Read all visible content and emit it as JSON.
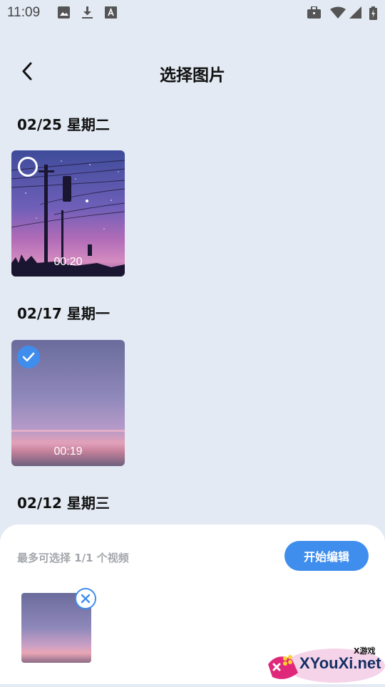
{
  "status_bar": {
    "time": "11:09",
    "left_icons": [
      "image-icon",
      "download-icon",
      "font-a-icon"
    ],
    "right_icons": [
      "briefcase-icon",
      "wifi-icon",
      "signal-icon",
      "battery-charging-icon"
    ]
  },
  "header": {
    "back_icon": "chevron-left-icon",
    "title": "选择图片"
  },
  "groups": [
    {
      "date": "02/25 星期二",
      "items": [
        {
          "duration": "00:20",
          "selected": false
        }
      ]
    },
    {
      "date": "02/17 星期一",
      "items": [
        {
          "duration": "00:19",
          "selected": true
        }
      ]
    },
    {
      "date": "02/12 星期三",
      "items": []
    }
  ],
  "bottom_panel": {
    "limit_text": "最多可选择 1/1 个视频",
    "start_button_label": "开始编辑",
    "remove_icon": "close-icon"
  },
  "watermark": {
    "site": "XYouXi.net",
    "tag": "X游戏"
  },
  "colors": {
    "background": "#e3eaf4",
    "accent": "#3f8ded",
    "panel": "#ffffff"
  }
}
